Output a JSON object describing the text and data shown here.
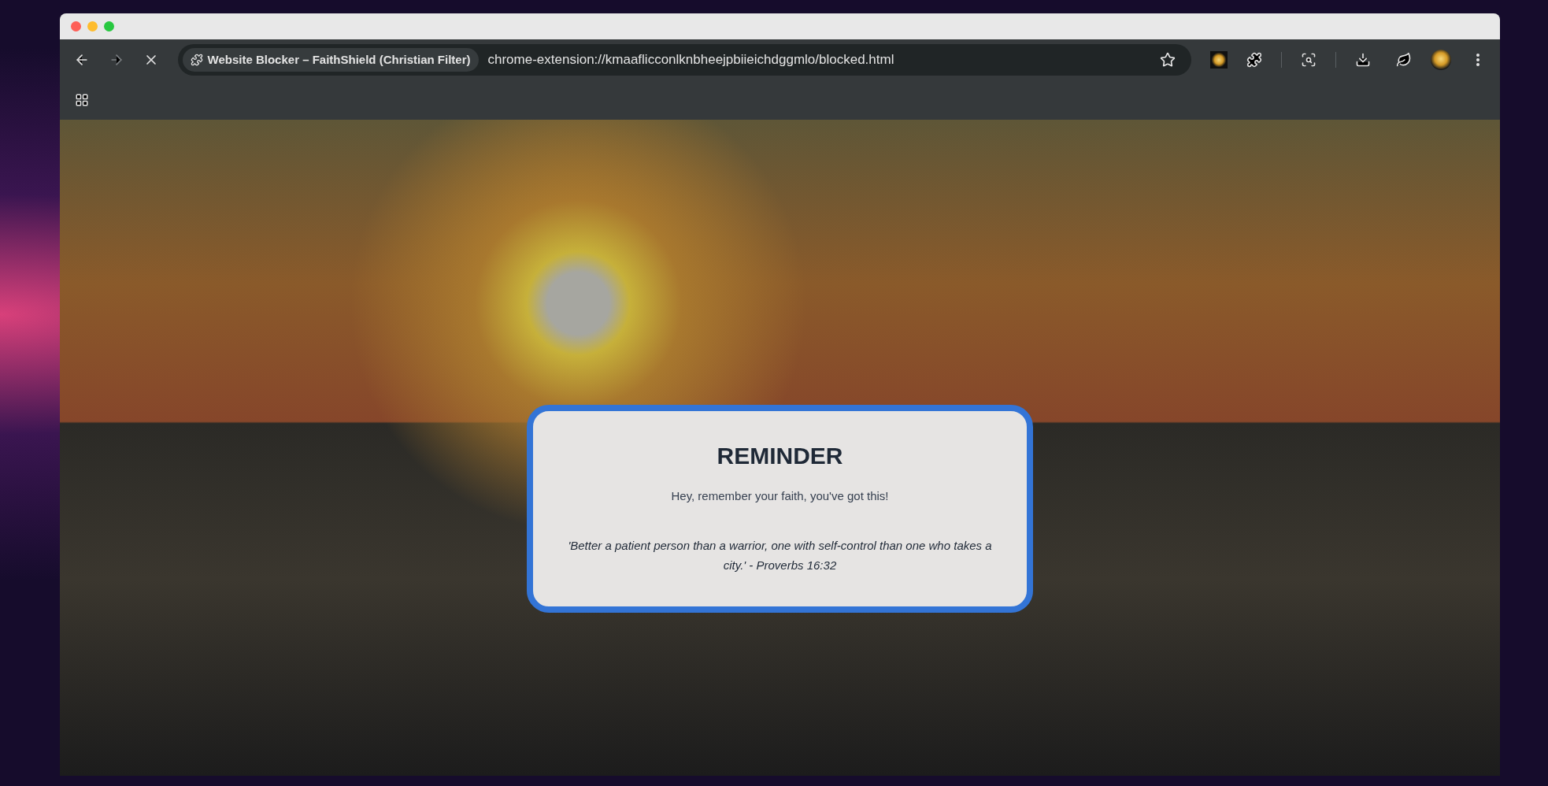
{
  "toolbar": {
    "forward_enabled": false,
    "loading": true,
    "bookmarked": false
  },
  "address_bar": {
    "chip": "Website Blocker – FaithShield (Christian Filter)",
    "url": "chrome-extension://kmaaflicconlknbheejpbiieichdggmlo/blocked.html"
  },
  "card": {
    "title": "REMINDER",
    "message": "Hey, remember your faith, you've got this!",
    "quote": "'Better a patient person than a warrior, one with self-control than one who takes a city.' - Proverbs 16:32"
  }
}
